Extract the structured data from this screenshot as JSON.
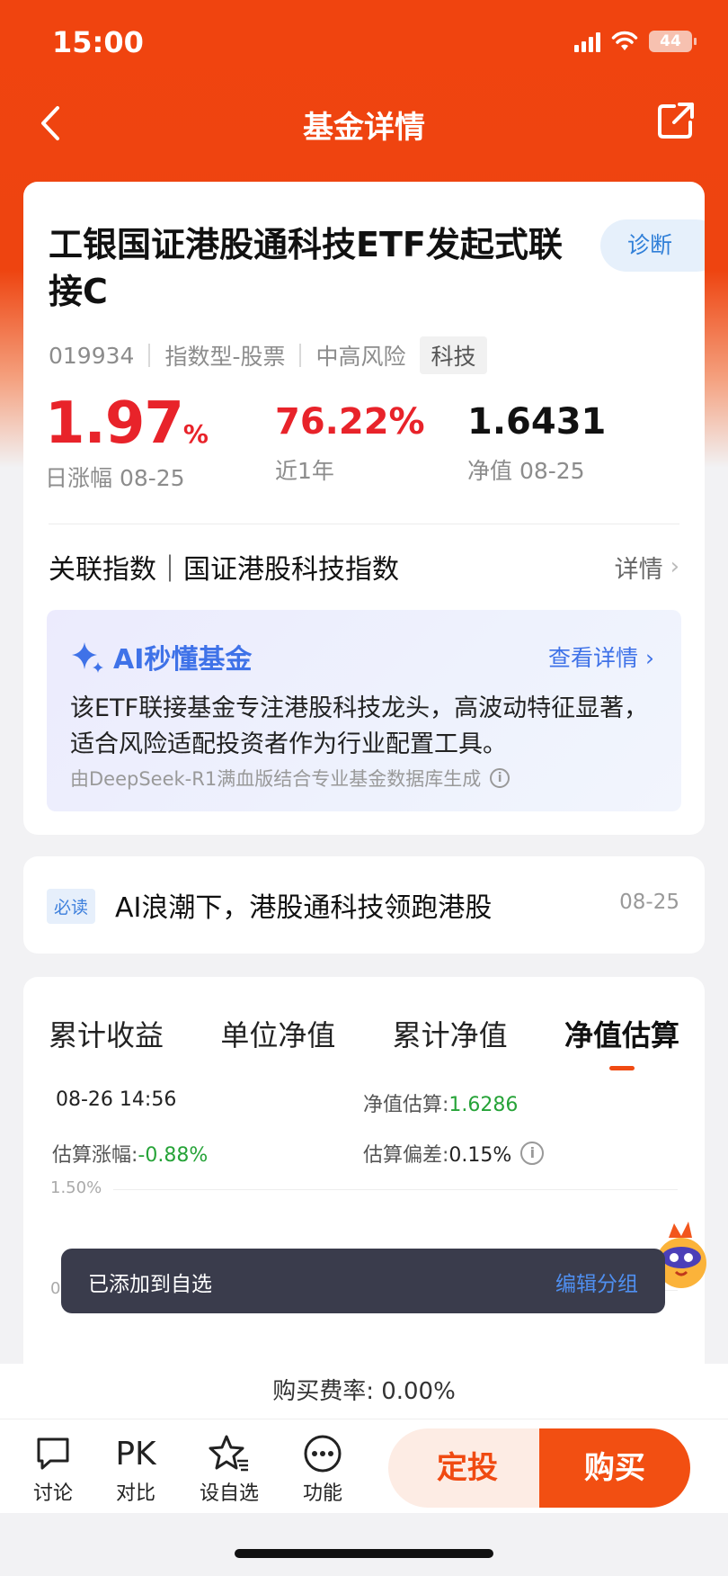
{
  "status": {
    "time": "15:00",
    "battery": "44"
  },
  "nav": {
    "title": "基金详情"
  },
  "fund": {
    "name": "工银国证港股通科技ETF发起式联接C",
    "diagnose_label": "诊断",
    "code": "019934",
    "type": "指数型-股票",
    "risk": "中高风险",
    "tag": "科技",
    "daily_change": "1.97",
    "daily_change_unit": "%",
    "daily_change_label": "日涨幅 08-25",
    "year_change": "76.22%",
    "year_change_label": "近1年",
    "nav_value": "1.6431",
    "nav_label": "净值 08-25"
  },
  "index": {
    "label": "关联指数｜国证港股科技指数",
    "more": "详情"
  },
  "ai": {
    "title": "AI秒懂基金",
    "more": "查看详情",
    "body": "该ETF联接基金专注港股科技龙头，高波动特征显著，适合风险适配投资者作为行业配置工具。",
    "footer": "由DeepSeek-R1满血版结合专业基金数据库生成"
  },
  "news": {
    "tag": "必读",
    "title": "AI浪潮下，港股通科技领跑港股",
    "date": "08-25"
  },
  "chart_tabs": [
    "累计收益",
    "单位净值",
    "累计净值",
    "净值估算"
  ],
  "estimate": {
    "time": "08-26 14:56",
    "value_label": "净值估算:",
    "value": "1.6286",
    "change_label": "估算涨幅:",
    "change": "-0.88%",
    "deviation_label": "估算偏差:",
    "deviation": "0.15%"
  },
  "chart_axis": {
    "top": "1.50%",
    "mid": "0.75%"
  },
  "toast": {
    "text": "已添加到自选",
    "action": "编辑分组"
  },
  "fee": "购买费率: 0.00%",
  "bottom": {
    "discuss": "讨论",
    "compare_icon": "PK",
    "compare": "对比",
    "watchlist": "设自选",
    "more": "功能",
    "dingtou": "定投",
    "buy": "购买"
  }
}
